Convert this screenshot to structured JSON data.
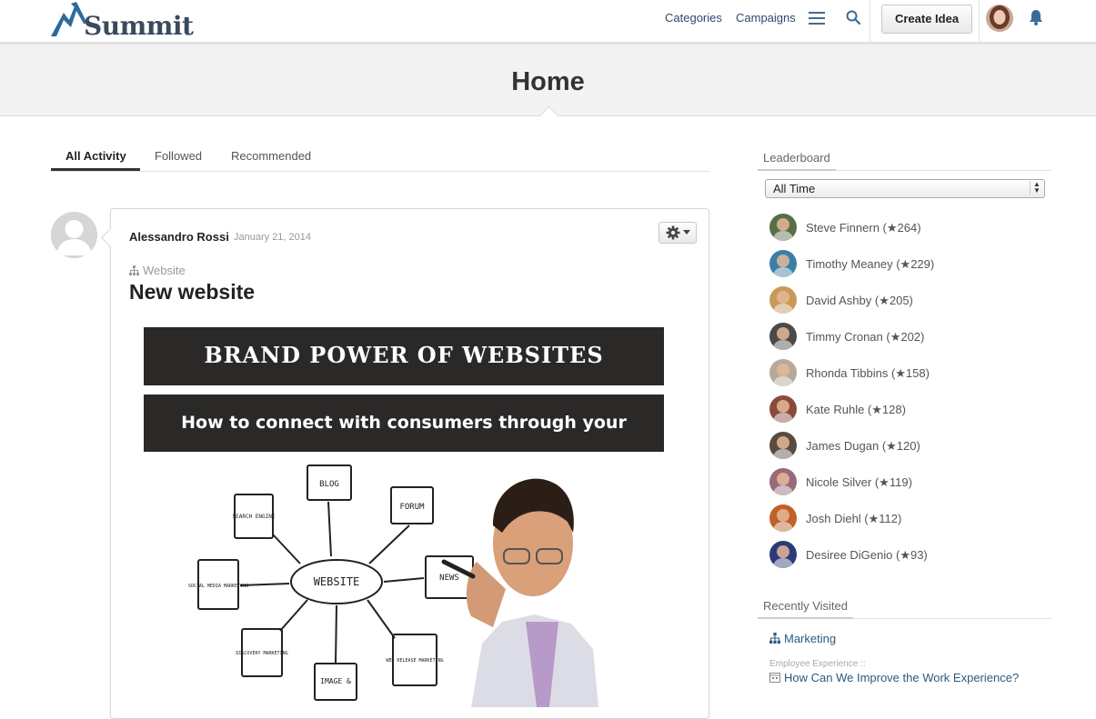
{
  "brand": {
    "name": "Summit"
  },
  "nav": {
    "categories_label": "Categories",
    "campaigns_label": "Campaigns",
    "create_idea_label": "Create Idea"
  },
  "page": {
    "title": "Home"
  },
  "tabs": [
    {
      "label": "All Activity",
      "active": true
    },
    {
      "label": "Followed",
      "active": false
    },
    {
      "label": "Recommended",
      "active": false
    }
  ],
  "post": {
    "author": "Alessandro Rossi",
    "date": "January 21, 2014",
    "category": "Website",
    "title": "New website",
    "image": {
      "banner_title": "BRAND POWER OF WEBSITES",
      "banner_subtitle": "How to connect with consumers through your website",
      "diagram_center": "WEBSITE",
      "diagram_nodes": [
        "BLOG",
        "FORUM",
        "SEARCH ENGINE",
        "SOCIAL MEDIA MARKETING",
        "NEWS",
        "DISCOVERY MARKETING",
        "IMAGE &",
        "WEB RELEASE MARKETING"
      ]
    }
  },
  "leaderboard": {
    "heading": "Leaderboard",
    "filter_value": "All Time",
    "entries": [
      {
        "name": "Steve Finnern (★264)",
        "color": "#5a6e48"
      },
      {
        "name": "Timothy Meaney (★229)",
        "color": "#3a7fa8"
      },
      {
        "name": "David Ashby (★205)",
        "color": "#c89a5a"
      },
      {
        "name": "Timmy Cronan (★202)",
        "color": "#4a4a4a"
      },
      {
        "name": "Rhonda Tibbins (★158)",
        "color": "#b7a99a"
      },
      {
        "name": "Kate Ruhle (★128)",
        "color": "#8a4a3a"
      },
      {
        "name": "James Dugan (★120)",
        "color": "#5a4a40"
      },
      {
        "name": "Nicole Silver (★119)",
        "color": "#9a6a7a"
      },
      {
        "name": "Josh Diehl (★112)",
        "color": "#c0602a"
      },
      {
        "name": "Desiree DiGenio (★93)",
        "color": "#2a3a7a"
      }
    ]
  },
  "recently_visited": {
    "heading": "Recently Visited",
    "items": [
      {
        "label": "Marketing",
        "prefix": ""
      },
      {
        "label": "How Can We Improve the Work Experience?",
        "prefix": "Employee Experience ::"
      }
    ]
  },
  "colors": {
    "link": "#2c4a6b",
    "accent": "#3a7fb0"
  }
}
